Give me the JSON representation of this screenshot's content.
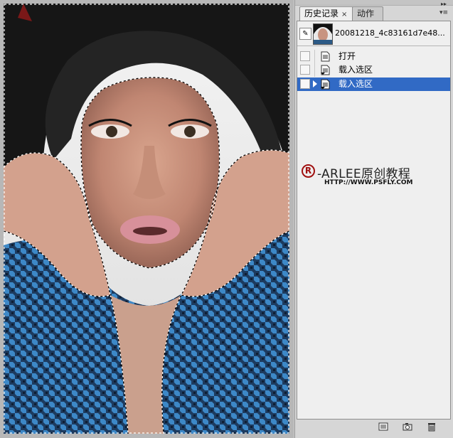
{
  "panel": {
    "tabs": [
      {
        "label": "历史记录",
        "close": "×"
      },
      {
        "label": "动作"
      }
    ],
    "snapshot": {
      "label": "20081218_4c83161d7e48..."
    },
    "history": [
      {
        "label": "打开",
        "selected": false
      },
      {
        "label": "载入选区",
        "selected": false
      },
      {
        "label": "载入选区",
        "selected": true
      }
    ],
    "watermark": {
      "mark": "R",
      "text": "-ARLEE原创教程",
      "url": "HTTP://WWW.PSFLY.COM"
    },
    "icons": {
      "panel_menu": "panel-menu-icon",
      "brush": "history-brush-icon",
      "new_doc": "new-document-icon",
      "snapshot": "camera-icon",
      "delete": "trash-icon"
    }
  },
  "colors": {
    "selection_row": "#316ac5",
    "watermark_mark": "#a01010"
  }
}
